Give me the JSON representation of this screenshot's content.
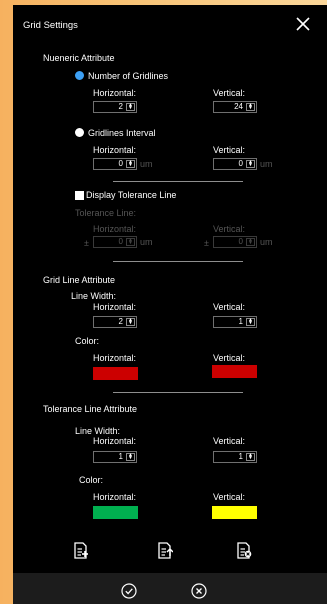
{
  "dialog": {
    "title": "Grid Settings"
  },
  "numeric": {
    "heading": "Nueneric Attribute",
    "mode_count_label": "Number of Gridlines",
    "mode_interval_label": "Gridlines Interval",
    "selected_mode": "count",
    "count": {
      "horizontal_label": "Horizontal:",
      "vertical_label": "Vertical:",
      "horizontal": "2",
      "vertical": "24"
    },
    "interval": {
      "horizontal_label": "Horizontal:",
      "vertical_label": "Vertical:",
      "horizontal": "0",
      "vertical": "0",
      "unit": "um"
    }
  },
  "tolerance": {
    "checkbox_label": "Display Tolerance Line",
    "checked": false,
    "line_label": "Tolerance Line:",
    "horizontal_label": "Horizontal:",
    "vertical_label": "Vertical:",
    "pm": "±",
    "horizontal": "0",
    "vertical": "0",
    "unit": "um"
  },
  "grid_line": {
    "heading": "Grid Line Attribute",
    "width_label": "Line Width:",
    "horizontal_label": "Horizontal:",
    "vertical_label": "Vertical:",
    "width_horizontal": "2",
    "width_vertical": "1",
    "color_label": "Color:",
    "color_horizontal_label": "Horizontal:",
    "color_vertical_label": "Vertical:",
    "color_horizontal": "#cc0000",
    "color_vertical": "#cc0000"
  },
  "tolerance_line": {
    "heading": "Tolerance Line Attribute",
    "width_label": "Line Width:",
    "horizontal_label": "Horizontal:",
    "vertical_label": "Vertical:",
    "width_horizontal": "1",
    "width_vertical": "1",
    "color_label": "Color:",
    "color_horizontal_label": "Horizontal:",
    "color_vertical_label": "Vertical:",
    "color_horizontal": "#00b050",
    "color_vertical": "#ffff00"
  },
  "toolbar_icons": [
    "add-config-icon",
    "load-config-icon",
    "delete-config-icon"
  ],
  "footer_icons": [
    "confirm-icon",
    "cancel-icon"
  ],
  "colors": {
    "accent": "#3da0f5",
    "background": "#000000"
  }
}
